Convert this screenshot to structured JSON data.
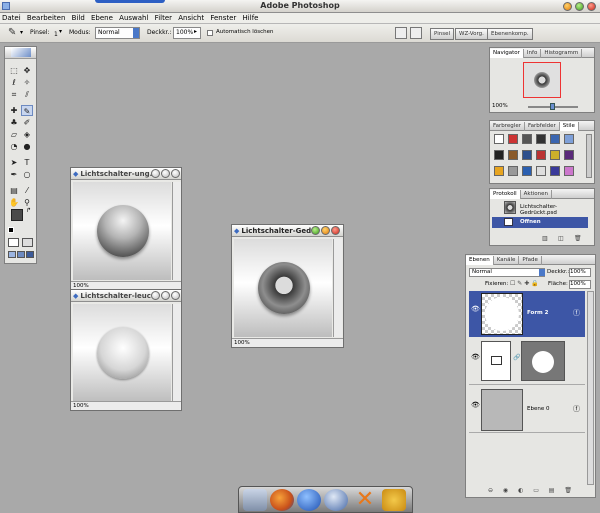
{
  "app": {
    "title": "Adobe Photoshop"
  },
  "menu": [
    "Datei",
    "Bearbeiten",
    "Bild",
    "Ebene",
    "Auswahl",
    "Filter",
    "Ansicht",
    "Fenster",
    "Hilfe"
  ],
  "options": {
    "pinsel_label": "Pinsel:",
    "pinsel_size": "1",
    "modus_label": "Modus:",
    "modus_value": "Normal",
    "deckkraft_label": "Deckkr.:",
    "deckkraft_value": "100%",
    "auto_delete_label": "Automatisch löschen",
    "tabs": [
      "Pinsel",
      "WZ-Vorg.",
      "Ebenenkomp."
    ]
  },
  "navigator": {
    "tabs": [
      "Navigator",
      "Info",
      "Histogramm"
    ],
    "zoom": "100%"
  },
  "styles": {
    "tabs": [
      "Farbregler",
      "Farbfelder",
      "Stile"
    ]
  },
  "history": {
    "tabs": [
      "Protokoll",
      "Aktionen"
    ],
    "items": [
      "Lichtschalter-Gedrückt.psd",
      "Offnen"
    ]
  },
  "layers": {
    "tabs": [
      "Ebenen",
      "Kanäle",
      "Pfade"
    ],
    "blend_mode": "Normal",
    "opacity_label": "Deckkr.:",
    "opacity_value": "100%",
    "lock_label": "Fixieren:",
    "fill_label": "Fläche:",
    "fill_value": "100%",
    "items": [
      {
        "name": "Form 2",
        "selected": true
      },
      {
        "name": "",
        "selected": false
      },
      {
        "name": "Ebene 0",
        "selected": false
      }
    ]
  },
  "documents": [
    {
      "title": "Lichtschalter-ung...",
      "zoom": "100%"
    },
    {
      "title": "Lichtschalter-leuc...",
      "zoom": "100%"
    },
    {
      "title": "Lichtschalter-Ged...",
      "zoom": "100%"
    }
  ],
  "dock": [
    "trash",
    "firefox",
    "globe",
    "thunderbird",
    "x-tool",
    "app"
  ],
  "colors": {
    "accent": "#3d56a6",
    "workspace": "#a9a9a9"
  }
}
